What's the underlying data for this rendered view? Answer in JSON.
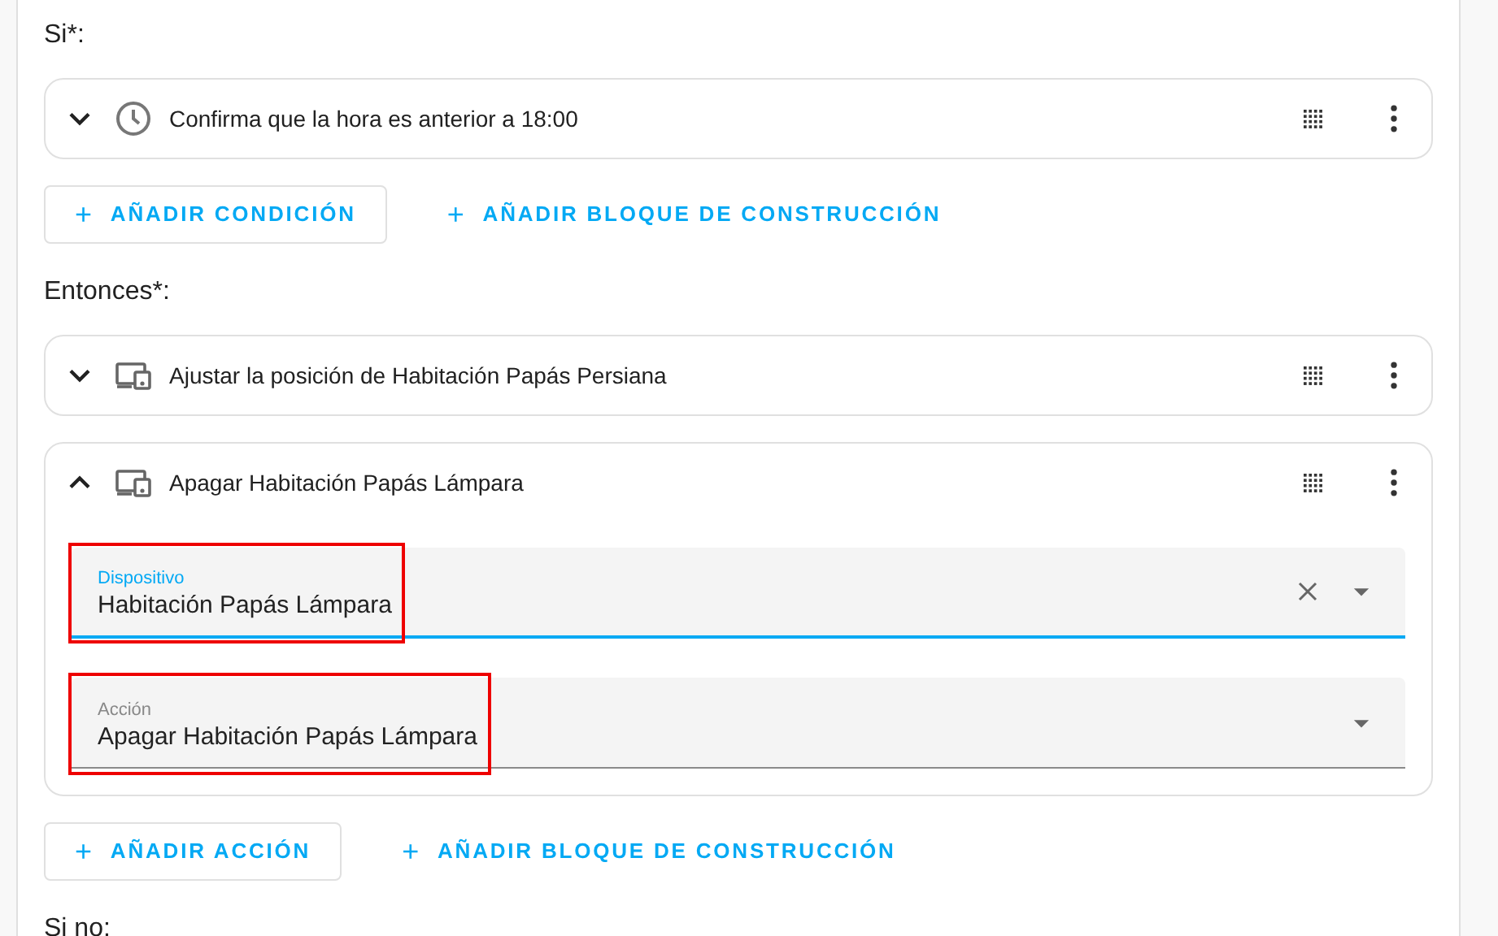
{
  "sections": [
    {
      "heading": "Si*:",
      "items": [
        {
          "kind": "clock",
          "title": "Confirma que la hora es anterior a 18:00",
          "expanded": false
        }
      ],
      "buttons": [
        {
          "icon": "+",
          "label": "AÑADIR CONDICIÓN",
          "outlined": true
        },
        {
          "icon": "+",
          "label": "AÑADIR BLOQUE DE CONSTRUCCIÓN",
          "outlined": false
        }
      ]
    },
    {
      "heading": "Entonces*:",
      "items": [
        {
          "kind": "device",
          "title": "Ajustar la posición de Habitación Papás Persiana",
          "expanded": false
        },
        {
          "kind": "device",
          "title": "Apagar Habitación Papás Lámpara",
          "expanded": true,
          "fields": [
            {
              "label": "Dispositivo",
              "value": "Habitación Papás Lámpara",
              "focused": true,
              "clearable": true,
              "highlighted": true
            },
            {
              "label": "Acción",
              "value": "Apagar Habitación Papás Lámpara",
              "focused": false,
              "clearable": false,
              "highlighted": true
            }
          ]
        }
      ],
      "buttons": [
        {
          "icon": "+",
          "label": "AÑADIR ACCIÓN",
          "outlined": true
        },
        {
          "icon": "+",
          "label": "AÑADIR BLOQUE DE CONSTRUCCIÓN",
          "outlined": false
        }
      ]
    },
    {
      "heading": "Si no:"
    }
  ]
}
